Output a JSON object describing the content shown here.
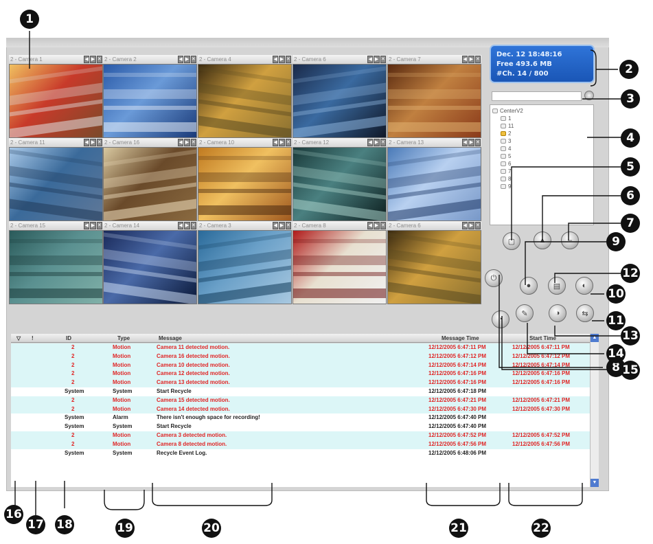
{
  "cameras": [
    {
      "title": "2 - Camera 1",
      "colors": [
        "#f0c060",
        "#c83a2a",
        "#e0e0e0",
        "#7a4a2a"
      ]
    },
    {
      "title": "2 - Camera 2",
      "colors": [
        "#2a5aa8",
        "#6a9ad8",
        "#e8eef8",
        "#1a3a78"
      ]
    },
    {
      "title": "2 - Camera 4",
      "colors": [
        "#3a2a10",
        "#d0a040",
        "#5a4a20",
        "#8a7030"
      ]
    },
    {
      "title": "2 - Camera 6",
      "colors": [
        "#1a2a4a",
        "#3a6aa0",
        "#8ab0d8",
        "#101828"
      ]
    },
    {
      "title": "2 - Camera 7",
      "colors": [
        "#5a2a10",
        "#c08040",
        "#e0b070",
        "#8a3a1a"
      ]
    },
    {
      "title": "2 - Camera 11",
      "colors": [
        "#a8c8e8",
        "#3a6a9a",
        "#203a5a",
        "#607898"
      ]
    },
    {
      "title": "2 - Camera 16",
      "colors": [
        "#d8c8a0",
        "#6a4a2a",
        "#f0e0c0",
        "#8a6a40"
      ]
    },
    {
      "title": "2 - Camera 10",
      "colors": [
        "#c07a20",
        "#f0c060",
        "#4a2a10",
        "#a05a20"
      ]
    },
    {
      "title": "2 - Camera 12",
      "colors": [
        "#1a3a3a",
        "#4a8080",
        "#a8d0c8",
        "#0e2020"
      ]
    },
    {
      "title": "2 - Camera 13",
      "colors": [
        "#4a7ab8",
        "#b8d0f0",
        "#203a68",
        "#7898c8"
      ]
    },
    {
      "title": "2 - Camera 15",
      "colors": [
        "#2a5a5a",
        "#5a9090",
        "#1a3a3a",
        "#80b0a8"
      ]
    },
    {
      "title": "2 - Camera 14",
      "colors": [
        "#1a2a5a",
        "#4a6aa8",
        "#c8d8f0",
        "#0a1838"
      ]
    },
    {
      "title": "2 - Camera 3",
      "colors": [
        "#2a6a9a",
        "#6aa0c8",
        "#103a5a",
        "#a8c8e0"
      ]
    },
    {
      "title": "2 - Camera 8",
      "colors": [
        "#b01a1a",
        "#e8e0d0",
        "#6a1010",
        "#f0f0f0"
      ]
    },
    {
      "title": "2 - Camera 6",
      "colors": [
        "#3a2a10",
        "#d0a040",
        "#5a4a20",
        "#8a7030"
      ]
    }
  ],
  "cam_buttons": [
    "◀",
    "▶",
    "✕"
  ],
  "status": {
    "line1": "Dec. 12 18:48:16",
    "line2": "Free 493.6 MB",
    "line3": "#Ch. 14 / 800"
  },
  "tree": {
    "root": "CenterV2",
    "items": [
      "1",
      "11",
      "2",
      "3",
      "4",
      "5",
      "6",
      "7",
      "8",
      "9"
    ]
  },
  "toolbar_icons": [
    "▢",
    "▲",
    "–",
    "●",
    "▤",
    "◐",
    "✎",
    "◔",
    "◑",
    "⇆",
    "⏻"
  ],
  "log": {
    "headers": {
      "filter": "▽",
      "flag": "!",
      "id": "ID",
      "type": "Type",
      "message": "Message",
      "msgtime": "Message Time",
      "start": "Start Time"
    },
    "rows": [
      {
        "id": "2",
        "type": "Motion",
        "message": "Camera 11 detected motion.",
        "msgtime": "12/12/2005 6:47:11 PM",
        "start": "12/12/2005 6:47:11 PM",
        "alt": true,
        "red": true
      },
      {
        "id": "2",
        "type": "Motion",
        "message": "Camera 16 detected motion.",
        "msgtime": "12/12/2005 6:47:12 PM",
        "start": "12/12/2005 6:47:12 PM",
        "alt": true,
        "red": true
      },
      {
        "id": "2",
        "type": "Motion",
        "message": "Camera 10 detected motion.",
        "msgtime": "12/12/2005 6:47:14 PM",
        "start": "12/12/2005 6:47:14 PM",
        "alt": true,
        "red": true
      },
      {
        "id": "2",
        "type": "Motion",
        "message": "Camera 12 detected motion.",
        "msgtime": "12/12/2005 6:47:16 PM",
        "start": "12/12/2005 6:47:16 PM",
        "alt": true,
        "red": true
      },
      {
        "id": "2",
        "type": "Motion",
        "message": "Camera 13 detected motion.",
        "msgtime": "12/12/2005 6:47:16 PM",
        "start": "12/12/2005 6:47:16 PM",
        "alt": true,
        "red": true
      },
      {
        "id": "System",
        "type": "System",
        "message": "Start Recycle",
        "msgtime": "12/12/2005 6:47:18 PM",
        "start": "",
        "alt": false,
        "red": false
      },
      {
        "id": "2",
        "type": "Motion",
        "message": "Camera 15 detected motion.",
        "msgtime": "12/12/2005 6:47:21 PM",
        "start": "12/12/2005 6:47:21 PM",
        "alt": true,
        "red": true
      },
      {
        "id": "2",
        "type": "Motion",
        "message": "Camera 14 detected motion.",
        "msgtime": "12/12/2005 6:47:30 PM",
        "start": "12/12/2005 6:47:30 PM",
        "alt": true,
        "red": true
      },
      {
        "id": "System",
        "type": "Alarm",
        "message": "There isn't enough space for recording!",
        "msgtime": "12/12/2005 6:47:40 PM",
        "start": "",
        "alt": false,
        "red": false
      },
      {
        "id": "System",
        "type": "System",
        "message": "Start Recycle",
        "msgtime": "12/12/2005 6:47:40 PM",
        "start": "",
        "alt": false,
        "red": false
      },
      {
        "id": "2",
        "type": "Motion",
        "message": "Camera 3 detected motion.",
        "msgtime": "12/12/2005 6:47:52 PM",
        "start": "12/12/2005 6:47:52 PM",
        "alt": true,
        "red": true
      },
      {
        "id": "2",
        "type": "Motion",
        "message": "Camera 8 detected motion.",
        "msgtime": "12/12/2005 6:47:56 PM",
        "start": "12/12/2005 6:47:56 PM",
        "alt": true,
        "red": true
      },
      {
        "id": "System",
        "type": "System",
        "message": "Recycle Event Log.",
        "msgtime": "12/12/2005 6:48:06 PM",
        "start": "",
        "alt": false,
        "red": false
      }
    ]
  },
  "scroll": {
    "up": "▲",
    "down": "▼"
  },
  "callouts": [
    "1",
    "2",
    "3",
    "4",
    "5",
    "6",
    "7",
    "8",
    "9",
    "10",
    "11",
    "12",
    "13",
    "14",
    "15",
    "16",
    "17",
    "18",
    "19",
    "20",
    "21",
    "22"
  ]
}
